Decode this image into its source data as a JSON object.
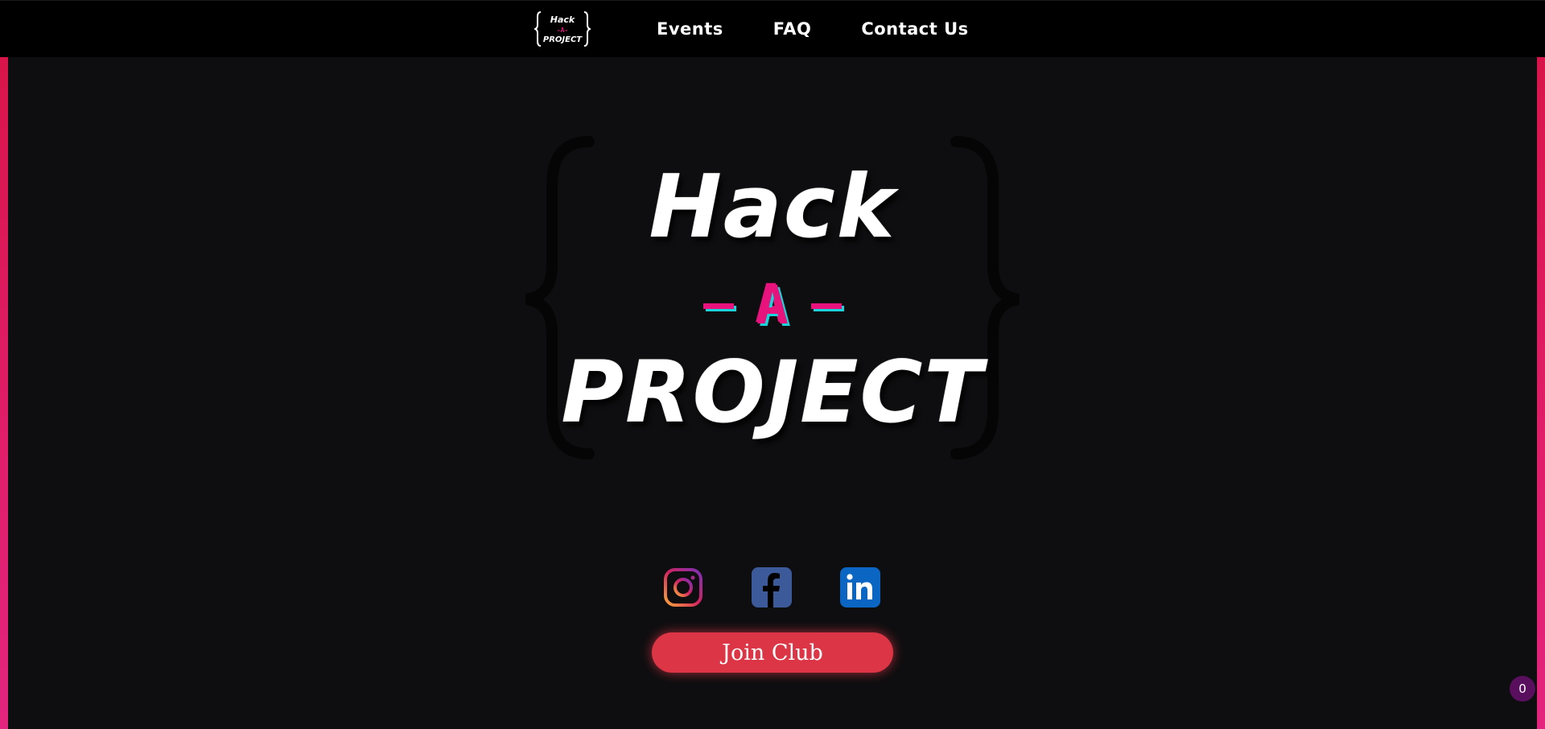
{
  "nav": {
    "logo": {
      "line1": "Hack",
      "line2": "-A-",
      "line3": "PROJECT"
    },
    "links": [
      "Events",
      "FAQ",
      "Contact Us"
    ]
  },
  "hero": {
    "word1": "Hack",
    "letter": "A",
    "word2": "PROJECT"
  },
  "socials": [
    {
      "name": "Instagram",
      "icon": "instagram-icon"
    },
    {
      "name": "Facebook",
      "icon": "facebook-icon"
    },
    {
      "name": "LinkedIn",
      "icon": "linkedin-icon"
    }
  ],
  "cta": {
    "label": "Join Club"
  },
  "notification_badge": {
    "count": "0"
  },
  "colors": {
    "accent_pink": "#e8137c",
    "accent_cyan": "#19d4da",
    "button_red": "#dc3545",
    "side_bar": "#d8154a"
  }
}
